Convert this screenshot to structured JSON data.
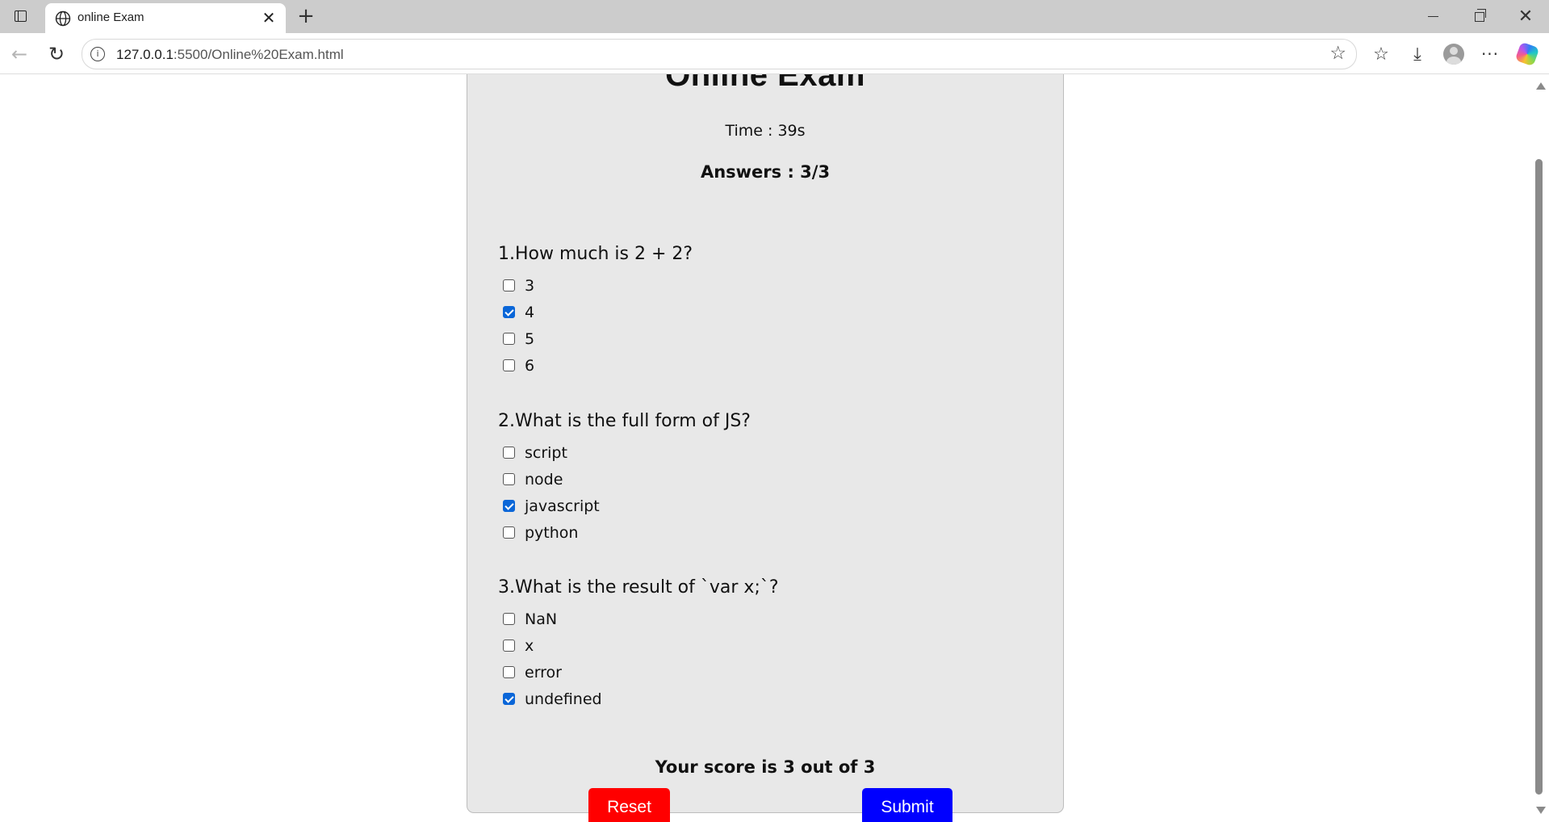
{
  "browser": {
    "tab_title": "online Exam",
    "url_host": "127.0.0.1",
    "url_path": ":5500/Online%20Exam.html"
  },
  "exam": {
    "title": "Online Exam",
    "timer": "Time : 39s",
    "answers_count": "Answers : 3/3",
    "questions": [
      {
        "text": "1.How much is 2 + 2?",
        "options": [
          {
            "label": "3",
            "checked": false
          },
          {
            "label": "4",
            "checked": true
          },
          {
            "label": "5",
            "checked": false
          },
          {
            "label": "6",
            "checked": false
          }
        ]
      },
      {
        "text": "2.What is the full form of JS?",
        "options": [
          {
            "label": "script",
            "checked": false
          },
          {
            "label": "node",
            "checked": false
          },
          {
            "label": "javascript",
            "checked": true
          },
          {
            "label": "python",
            "checked": false
          }
        ]
      },
      {
        "text": "3.What is the result of `var x;`?",
        "options": [
          {
            "label": "NaN",
            "checked": false
          },
          {
            "label": "x",
            "checked": false
          },
          {
            "label": "error",
            "checked": false
          },
          {
            "label": "undefined",
            "checked": true
          }
        ]
      }
    ],
    "score": "Your score is 3 out of 3",
    "reset_label": "Reset",
    "submit_label": "Submit"
  },
  "colors": {
    "card_bg": "#e8e8e8",
    "reset_button": "#ff0000",
    "submit_button": "#0000ff",
    "checkbox_checked": "#0a66d8"
  }
}
